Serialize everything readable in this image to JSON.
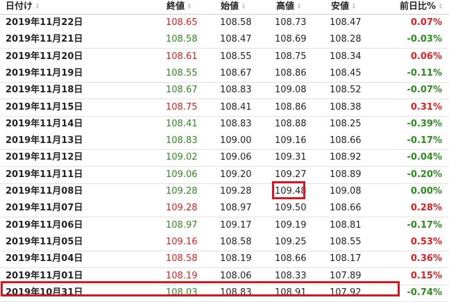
{
  "headers": {
    "date": "日付け",
    "close": "終値",
    "open": "始値",
    "high": "高値",
    "low": "安値",
    "change": "前日比%"
  },
  "sort_glyph": "⇕",
  "colors": {
    "up": "#e02020",
    "down": "#2e8b1f",
    "highlight": "#e0141e"
  },
  "rows": [
    {
      "date": "2019年11月22日",
      "close": "108.65",
      "open": "108.58",
      "high": "108.73",
      "low": "108.47",
      "change": "0.07%",
      "dir": "up"
    },
    {
      "date": "2019年11月21日",
      "close": "108.58",
      "open": "108.47",
      "high": "108.69",
      "low": "108.28",
      "change": "-0.03%",
      "dir": "down"
    },
    {
      "date": "2019年11月20日",
      "close": "108.61",
      "open": "108.55",
      "high": "108.75",
      "low": "108.34",
      "change": "0.06%",
      "dir": "up"
    },
    {
      "date": "2019年11月19日",
      "close": "108.55",
      "open": "108.67",
      "high": "108.86",
      "low": "108.45",
      "change": "-0.11%",
      "dir": "down"
    },
    {
      "date": "2019年11月18日",
      "close": "108.67",
      "open": "108.83",
      "high": "109.08",
      "low": "108.52",
      "change": "-0.07%",
      "dir": "down"
    },
    {
      "date": "2019年11月15日",
      "close": "108.75",
      "open": "108.41",
      "high": "108.86",
      "low": "108.38",
      "change": "0.31%",
      "dir": "up"
    },
    {
      "date": "2019年11月14日",
      "close": "108.41",
      "open": "108.83",
      "high": "108.88",
      "low": "108.25",
      "change": "-0.39%",
      "dir": "down"
    },
    {
      "date": "2019年11月13日",
      "close": "108.83",
      "open": "109.00",
      "high": "109.16",
      "low": "108.66",
      "change": "-0.17%",
      "dir": "down"
    },
    {
      "date": "2019年11月12日",
      "close": "109.02",
      "open": "109.06",
      "high": "109.31",
      "low": "108.92",
      "change": "-0.04%",
      "dir": "down"
    },
    {
      "date": "2019年11月11日",
      "close": "109.06",
      "open": "109.20",
      "high": "109.27",
      "low": "108.89",
      "change": "-0.20%",
      "dir": "down"
    },
    {
      "date": "2019年11月08日",
      "close": "109.28",
      "open": "109.28",
      "high": "109.48",
      "low": "109.08",
      "change": "0.00%",
      "dir": "flat"
    },
    {
      "date": "2019年11月07日",
      "close": "109.28",
      "open": "108.97",
      "high": "109.50",
      "low": "108.66",
      "change": "0.28%",
      "dir": "up"
    },
    {
      "date": "2019年11月06日",
      "close": "108.97",
      "open": "109.17",
      "high": "109.19",
      "low": "108.81",
      "change": "-0.17%",
      "dir": "down"
    },
    {
      "date": "2019年11月05日",
      "close": "109.16",
      "open": "108.58",
      "high": "109.25",
      "low": "108.55",
      "change": "0.53%",
      "dir": "up"
    },
    {
      "date": "2019年11月04日",
      "close": "108.58",
      "open": "108.19",
      "high": "108.66",
      "low": "108.17",
      "change": "0.36%",
      "dir": "up"
    },
    {
      "date": "2019年11月01日",
      "close": "108.19",
      "open": "108.06",
      "high": "108.33",
      "low": "107.89",
      "change": "0.15%",
      "dir": "up"
    },
    {
      "date": "2019年10月31日",
      "close": "108.03",
      "open": "108.83",
      "high": "108.91",
      "low": "107.92",
      "change": "-0.74%",
      "dir": "down"
    }
  ],
  "highlights": [
    {
      "row": 10,
      "column": "high"
    },
    {
      "row": 16,
      "column": "row-through-low"
    }
  ]
}
